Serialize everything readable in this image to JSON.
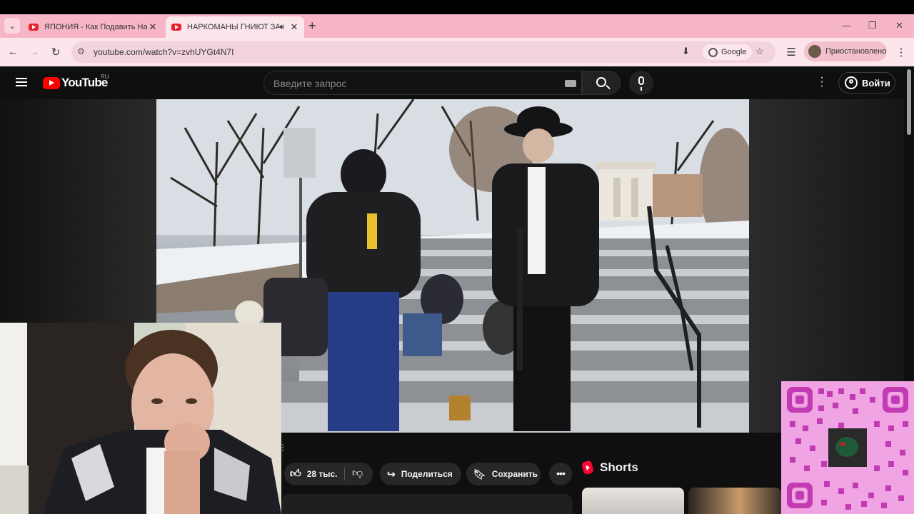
{
  "browser": {
    "tabs": [
      {
        "title": "ЯПОНИЯ - Как Подавить Нац",
        "active": false
      },
      {
        "title": "НАРКОМАНЫ ГНИЮТ ЗА",
        "active": true
      }
    ],
    "url": "youtube.com/watch?v=zvhUYGt4N7I",
    "search_chip": "Google",
    "profile_status": "Приостановлено",
    "accent_color": "#f7b6c6"
  },
  "youtube": {
    "logo_text": "YouTube",
    "region": "RU",
    "search_placeholder": "Введите запрос",
    "signin_label": "Войти",
    "actions": {
      "likes": "28 тыс.",
      "share_label": "Поделиться",
      "save_label": "Сохранить"
    },
    "shorts_label": "Shorts"
  }
}
